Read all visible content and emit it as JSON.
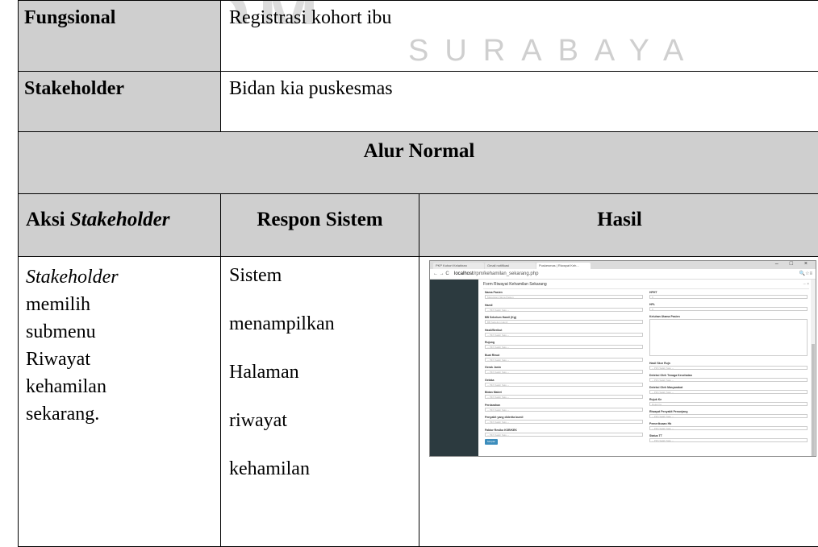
{
  "watermark": {
    "top": "SIKOM",
    "sub": "SURABAYA"
  },
  "rows": {
    "fungsional": {
      "label": "Fungsional",
      "value": "Registrasi kohort ibu"
    },
    "stakeholder": {
      "label": "Stakeholder",
      "value": "Bidan kia puskesmas"
    }
  },
  "alur_normal": "Alur Normal",
  "headers": {
    "aksi_prefix": "Aksi ",
    "aksi_em": "Stakeholder",
    "respon": "Respon Sistem",
    "hasil": "Hasil"
  },
  "aksi": {
    "em": "Stakeholder",
    "line1": "memilih",
    "line2": "submenu",
    "line3": "Riwayat",
    "line4": "kehamilan",
    "line5": "sekarang."
  },
  "respon": [
    "Sistem",
    "menampilkan",
    "Halaman",
    "riwayat",
    "kehamilan"
  ],
  "screenshot": {
    "tabs": [
      "PKP Kohort Kelahiran",
      "Gmail notifikasi",
      "Puskesmas | Riwayat Keh..."
    ],
    "win_controls": "– □ ×",
    "url_host": "localhost",
    "url_path": "/rpm/kehamilan_sekarang.php",
    "form_title": "Form Riwayat Kehamilan Sekarang",
    "form_title_icons": "– ×",
    "fields_left": [
      {
        "label": "Nama Pasien",
        "value": "Masukkan Nama Pasien"
      },
      {
        "label": "Hamil",
        "value": "-- Pilih Salah Satu --"
      },
      {
        "label": "BB Sebelum Hamil (Kg)",
        "value": "BB Sebelum Hamil"
      },
      {
        "label": "Hasil/Berikut",
        "value": "-- Pilih Salah Satu --"
      },
      {
        "label": "Rujung",
        "value": "-- Pilih Salah Satu --"
      },
      {
        "label": "Buat Riwut",
        "value": "-- Pilih Salah Satu --"
      },
      {
        "label": "Gerak Janin",
        "value": "-- Pilih Salah Satu --"
      },
      {
        "label": "Gelaka",
        "value": "-- Pilih Salah Satu --"
      },
      {
        "label": "Bidan Materi",
        "value": "-- Pilih Salah Satu --"
      },
      {
        "label": "Perdarahan",
        "value": "-- Pilih Salah Satu --"
      },
      {
        "label": "Penyakit yang diderita bumil",
        "value": "-- Pilih Salah Satu --"
      },
      {
        "label": "Faktor Resiko KSR/KEK",
        "value": "-- Pilih Salah Satu --"
      }
    ],
    "fields_right": [
      {
        "label": "HPHT",
        "value": "0"
      },
      {
        "label": "HPL",
        "value": "0"
      },
      {
        "label": "Keluhan Utama Pasien",
        "value": ""
      },
      {
        "label": "Hasil Skor Rujn",
        "value": "-- Pilih Salah Satu --"
      },
      {
        "label": "Deteksi Oleh Tenaga Kesehatan",
        "value": "-- Pilih Salah Satu --"
      },
      {
        "label": "Deteksi Oleh Masyarakat",
        "value": "-- Pilih Salah Satu --"
      },
      {
        "label": "Rujuk Ke",
        "value": "Rujuk Ke"
      },
      {
        "label": "Riwayat Penyakit Penunjang",
        "value": "-- Pilih Salah Satu --"
      },
      {
        "label": "Pemeriksaan Hb",
        "value": "-- Pilih Salah Satu --"
      },
      {
        "label": "Status TT",
        "value": "-- Pilih Salah Satu --"
      }
    ],
    "submit_label": "Simpan"
  }
}
